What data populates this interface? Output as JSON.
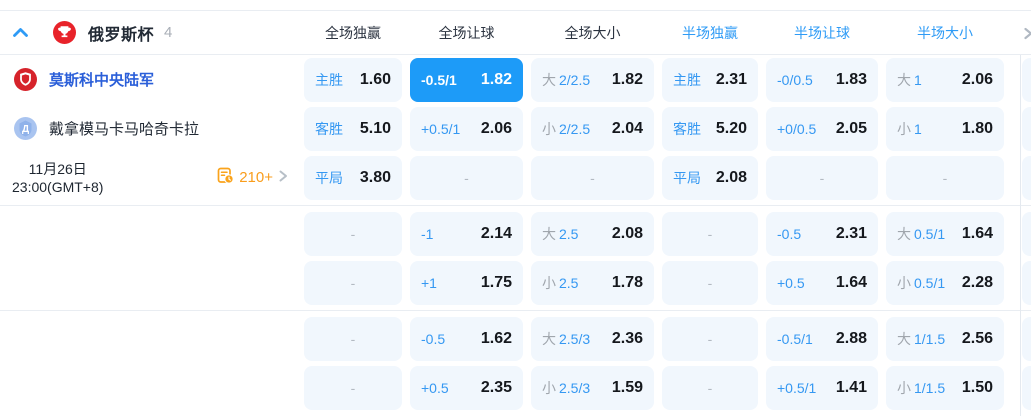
{
  "league": {
    "name": "俄罗斯杯",
    "count": "4"
  },
  "columns": [
    "全场独赢",
    "全场让球",
    "全场大小",
    "半场独赢",
    "半场让球",
    "半场大小"
  ],
  "match": {
    "home_team": "莫斯科中央陆军",
    "away_team": "戴拿模马卡马哈奇卡拉",
    "date": "11月26日",
    "time": "23:00(GMT+8)",
    "more_markets": "210+",
    "away_badge_letter": "Д"
  },
  "dash": "-",
  "rows": [
    {
      "cells": [
        {
          "label": "主胜",
          "value": "1.60"
        },
        {
          "label": "-0.5/1",
          "value": "1.82",
          "selected": true
        },
        {
          "prefix": "大",
          "label": "2/2.5",
          "value": "1.82"
        },
        {
          "label": "主胜",
          "value": "2.31"
        },
        {
          "label": "-0/0.5",
          "value": "1.83"
        },
        {
          "prefix": "大",
          "label": "1",
          "value": "2.06"
        }
      ]
    },
    {
      "cells": [
        {
          "label": "客胜",
          "value": "5.10"
        },
        {
          "label": "+0.5/1",
          "value": "2.06"
        },
        {
          "prefix": "小",
          "label": "2/2.5",
          "value": "2.04"
        },
        {
          "label": "客胜",
          "value": "5.20"
        },
        {
          "label": "+0/0.5",
          "value": "2.05"
        },
        {
          "prefix": "小",
          "label": "1",
          "value": "1.80"
        }
      ]
    },
    {
      "cells": [
        {
          "label": "平局",
          "value": "3.80"
        },
        {},
        {},
        {
          "label": "平局",
          "value": "2.08"
        },
        {},
        {}
      ]
    },
    {
      "cells": [
        {},
        {
          "label": "-1",
          "value": "2.14"
        },
        {
          "prefix": "大",
          "label": "2.5",
          "value": "2.08"
        },
        {},
        {
          "label": "-0.5",
          "value": "2.31"
        },
        {
          "prefix": "大",
          "label": "0.5/1",
          "value": "1.64"
        }
      ]
    },
    {
      "cells": [
        {},
        {
          "label": "+1",
          "value": "1.75"
        },
        {
          "prefix": "小",
          "label": "2.5",
          "value": "1.78"
        },
        {},
        {
          "label": "+0.5",
          "value": "1.64"
        },
        {
          "prefix": "小",
          "label": "0.5/1",
          "value": "2.28"
        }
      ]
    },
    {
      "cells": [
        {},
        {
          "label": "-0.5",
          "value": "1.62"
        },
        {
          "prefix": "大",
          "label": "2.5/3",
          "value": "2.36"
        },
        {},
        {
          "label": "-0.5/1",
          "value": "2.88"
        },
        {
          "prefix": "大",
          "label": "1/1.5",
          "value": "2.56"
        }
      ]
    },
    {
      "cells": [
        {},
        {
          "label": "+0.5",
          "value": "2.35"
        },
        {
          "prefix": "小",
          "label": "2.5/3",
          "value": "1.59"
        },
        {},
        {
          "label": "+0.5/1",
          "value": "1.41"
        },
        {
          "prefix": "小",
          "label": "1/1.5",
          "value": "1.50"
        }
      ]
    }
  ],
  "colors": {
    "accent_blue": "#2e9bf6",
    "selected_cell_bg": "#1d9bf8",
    "cell_bg": "#f1f7fd",
    "orange": "#f99d1c",
    "home_team_blue": "#2b5fd9",
    "value_dark": "#15181d",
    "league_badge_red": "#e8232a"
  }
}
